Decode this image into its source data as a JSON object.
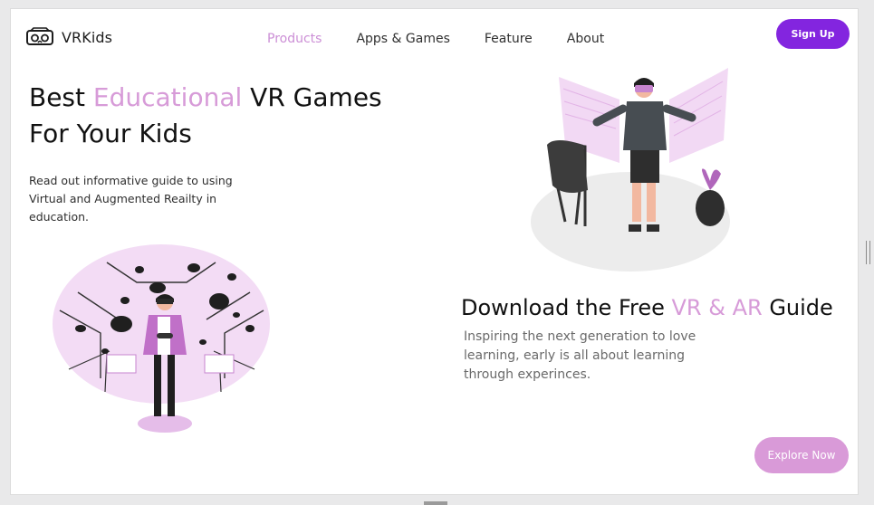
{
  "header": {
    "brand": "VRKids",
    "nav": [
      {
        "label": "Products",
        "active": true
      },
      {
        "label": "Apps & Games",
        "active": false
      },
      {
        "label": "Feature",
        "active": false
      },
      {
        "label": "About",
        "active": false
      }
    ],
    "signup_label": "Sign Up"
  },
  "hero": {
    "title_part1": "Best",
    "title_accent": "Educational",
    "title_part2": "VR Games",
    "title_line2": "For Your Kids",
    "description": "Read out informative guide to using Virtual and Augmented Reailty in education."
  },
  "guide": {
    "title_part1": "Download the Free",
    "title_accent": "VR & AR",
    "title_part2": "Guide",
    "description": "Inspiring the next generation to love learning, early is all about learning through experinces.",
    "cta_label": "Explore Now"
  },
  "colors": {
    "accent_purple": "#8325df",
    "accent_pink": "#d79bd8",
    "nav_active": "#cc8fd6"
  }
}
